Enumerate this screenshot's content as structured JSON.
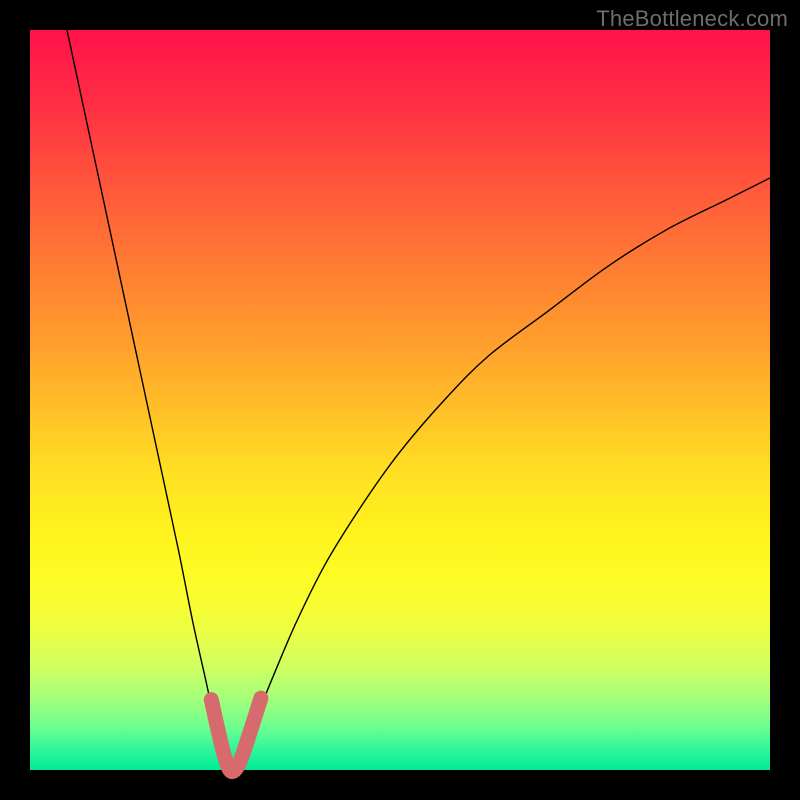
{
  "watermark": "TheBottleneck.com",
  "colors": {
    "gradient_top": "#ff124a",
    "gradient_bottom": "#00ec9a",
    "curve": "#000000",
    "highlight_segment": "#d76a6d",
    "frame": "#000000"
  },
  "chart_data": {
    "type": "line",
    "title": "",
    "xlabel": "",
    "ylabel": "",
    "xlim": [
      0,
      100
    ],
    "ylim": [
      0,
      100
    ],
    "grid": false,
    "legend": false,
    "note": "V-shaped / absolute-value-like curve. Minimum near x≈27, y≈0. Y rises steeply toward both x extremes; left branch steeper than right.",
    "series": [
      {
        "name": "curve",
        "x": [
          5,
          8,
          11,
          14,
          17,
          20,
          22,
          24,
          25,
          26,
          27,
          28,
          29,
          30,
          31,
          33,
          36,
          40,
          45,
          50,
          56,
          62,
          70,
          78,
          86,
          94,
          100
        ],
        "values": [
          100,
          86,
          72,
          58,
          44,
          30,
          20,
          11,
          6,
          2,
          0,
          0,
          2,
          5,
          8,
          13,
          20,
          28,
          36,
          43,
          50,
          56,
          62,
          68,
          73,
          77,
          80
        ]
      }
    ],
    "highlight": {
      "description": "thick salmon segment around the valley bottom",
      "x": [
        24.5,
        25.5,
        26.3,
        27,
        27.7,
        28.6,
        29.8,
        31.2
      ],
      "values": [
        9.5,
        5.0,
        1.8,
        0,
        0.0,
        1.7,
        5.3,
        9.7
      ]
    }
  }
}
